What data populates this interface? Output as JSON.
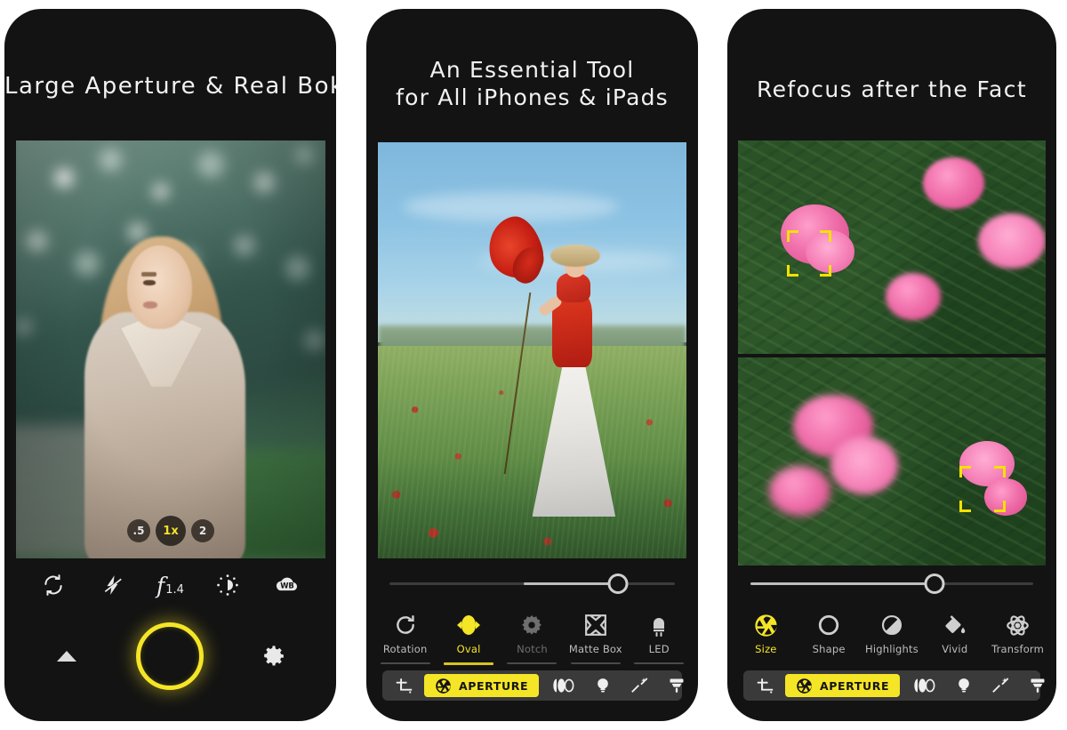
{
  "panels": [
    {
      "id": "panel-1",
      "headline": "Large Aperture & Real Bokeh",
      "zoom_pills": [
        {
          "label": ".5",
          "active": false
        },
        {
          "label": "1x",
          "active": true
        },
        {
          "label": "2",
          "active": false
        }
      ],
      "camera_controls": [
        {
          "name": "flip-camera-icon",
          "label": ""
        },
        {
          "name": "flash-off-icon",
          "label": ""
        },
        {
          "name": "aperture-fstop",
          "label": "f",
          "value": "1.4"
        },
        {
          "name": "exposure-icon",
          "label": ""
        },
        {
          "name": "white-balance-icon",
          "label": "WB"
        }
      ],
      "bottom_controls": [
        {
          "name": "expand-chevron-up-icon"
        },
        {
          "name": "shutter-button"
        },
        {
          "name": "settings-gear-icon"
        }
      ],
      "accent": "#f5e527"
    },
    {
      "id": "panel-2",
      "headline_line1": "An Essential Tool",
      "headline_line2": "for All iPhones & iPads",
      "slider": {
        "value_percent": 80,
        "fill_start_percent": 47
      },
      "tools": [
        {
          "label": "Rotation",
          "icon": "rotate-cw-icon",
          "state": "normal"
        },
        {
          "label": "Oval",
          "icon": "oval-aperture-icon",
          "state": "active"
        },
        {
          "label": "Notch",
          "icon": "notch-gear-icon",
          "state": "dim"
        },
        {
          "label": "Matte Box",
          "icon": "matte-box-icon",
          "state": "normal"
        },
        {
          "label": "LED",
          "icon": "led-icon",
          "state": "normal"
        }
      ],
      "tabbar": [
        {
          "label": "",
          "icon": "crop-icon",
          "active": false
        },
        {
          "label": "APERTURE",
          "icon": "aperture-icon",
          "active": true
        },
        {
          "label": "",
          "icon": "lens-blur-icon",
          "active": false
        },
        {
          "label": "",
          "icon": "lightbulb-icon",
          "active": false
        },
        {
          "label": "",
          "icon": "magic-wand-icon",
          "active": false
        },
        {
          "label": "",
          "icon": "brush-icon",
          "active": false
        }
      ],
      "accent": "#f5e527"
    },
    {
      "id": "panel-3",
      "headline": "Refocus after the Fact",
      "slider": {
        "value_percent": 65,
        "fill_start_percent": 0
      },
      "focus_reticles": [
        {
          "image": "top",
          "x_percent": 18,
          "y_percent": 46
        },
        {
          "image": "bottom",
          "x_percent": 74,
          "y_percent": 60
        }
      ],
      "tools": [
        {
          "label": "Size",
          "icon": "aperture-size-icon",
          "state": "active"
        },
        {
          "label": "Shape",
          "icon": "circle-shape-icon",
          "state": "normal"
        },
        {
          "label": "Highlights",
          "icon": "highlights-icon",
          "state": "normal"
        },
        {
          "label": "Vivid",
          "icon": "paint-bucket-icon",
          "state": "normal"
        },
        {
          "label": "Transform",
          "icon": "transform-atom-icon",
          "state": "normal"
        }
      ],
      "tabbar": [
        {
          "label": "",
          "icon": "crop-icon",
          "active": false
        },
        {
          "label": "APERTURE",
          "icon": "aperture-icon",
          "active": true
        },
        {
          "label": "",
          "icon": "lens-blur-icon",
          "active": false
        },
        {
          "label": "",
          "icon": "lightbulb-icon",
          "active": false
        },
        {
          "label": "",
          "icon": "magic-wand-icon",
          "active": false
        },
        {
          "label": "",
          "icon": "brush-icon",
          "active": false
        }
      ],
      "accent": "#f5e527"
    }
  ]
}
